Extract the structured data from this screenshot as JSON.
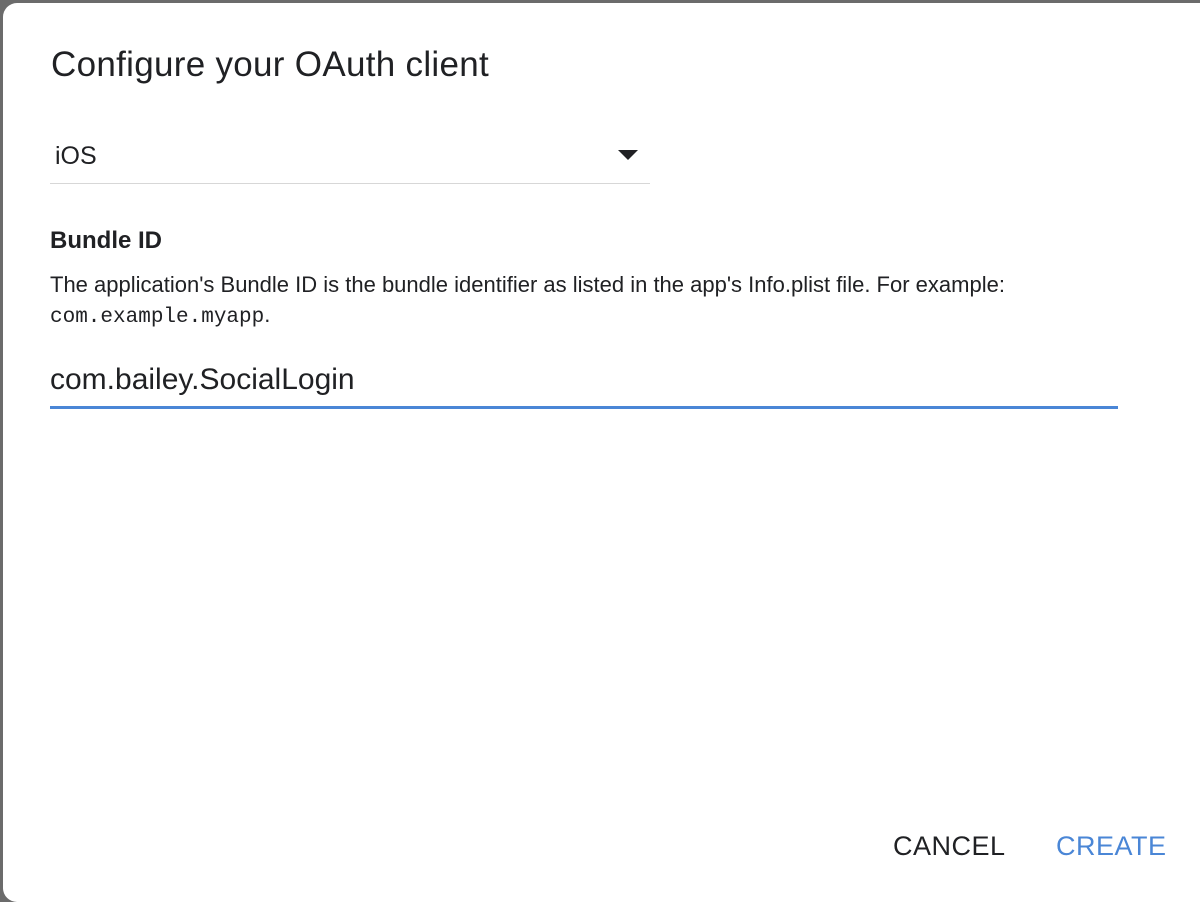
{
  "dialog": {
    "title": "Configure your OAuth client",
    "application_type": {
      "selected": "iOS"
    },
    "bundle_id": {
      "label": "Bundle ID",
      "help_text": "The application's Bundle ID is the bundle identifier as listed in the app's Info.plist file. For example: ",
      "help_example": "com.example.myapp",
      "help_suffix": ".",
      "value": "com.bailey.SocialLogin"
    },
    "actions": {
      "cancel_label": "CANCEL",
      "create_label": "CREATE"
    }
  },
  "colors": {
    "accent": "#4a86d6",
    "text": "#202124",
    "divider": "#d7d7d7"
  },
  "icons": {
    "dropdown": "caret-down-icon"
  }
}
